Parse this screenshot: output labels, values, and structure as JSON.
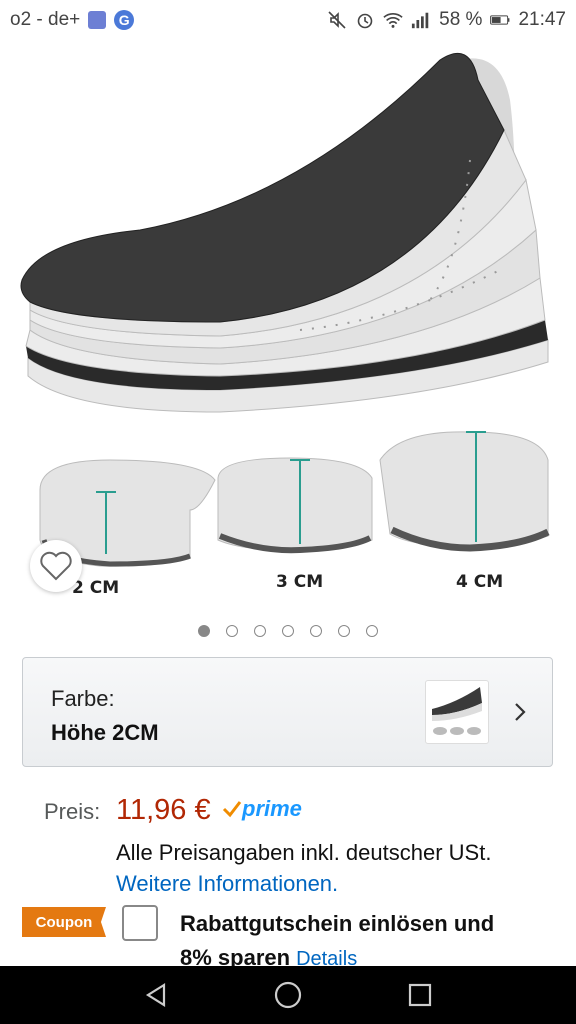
{
  "status_bar": {
    "carrier": "o2 - de+",
    "battery": "58 %",
    "time": "21:47",
    "g_letter": "G"
  },
  "product_image": {
    "labels": [
      "2 CM",
      "3 CM",
      "4 CM"
    ],
    "carousel_count": 7,
    "active_index": 0
  },
  "variation": {
    "label": "Farbe:",
    "value": "Höhe 2CM"
  },
  "price": {
    "label": "Preis:",
    "value": "11,96 €",
    "prime": "prime",
    "vat_note": "Alle Preisangaben inkl. deutscher USt.",
    "more_info": "Weitere Informationen."
  },
  "coupon": {
    "badge": "Coupon",
    "line1": "Rabattgutschein einlösen und",
    "line2": "8% sparen",
    "details": "Details"
  },
  "colors": {
    "price": "#b12704",
    "link": "#0066c0",
    "coupon": "#e47911",
    "prime": "#1a98ff"
  }
}
